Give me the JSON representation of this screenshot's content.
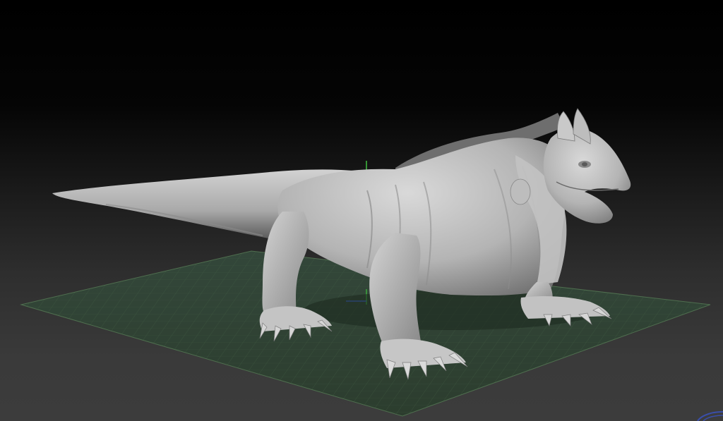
{
  "viewport": {
    "background_top": "#000000",
    "background_bottom": "#3c3c3c",
    "floor_grid_color": "#3f5a3f",
    "model_color": "#b9b9b9",
    "axis_x_color": "#3a5fd0",
    "axis_y_color": "#3fbf3f"
  },
  "scene": {
    "object": "lizard-sculpt",
    "floor": "grid-plane"
  },
  "icons": {
    "gizmo": "orientation-gizmo-icon",
    "axis": "axis-indicator-icon"
  }
}
